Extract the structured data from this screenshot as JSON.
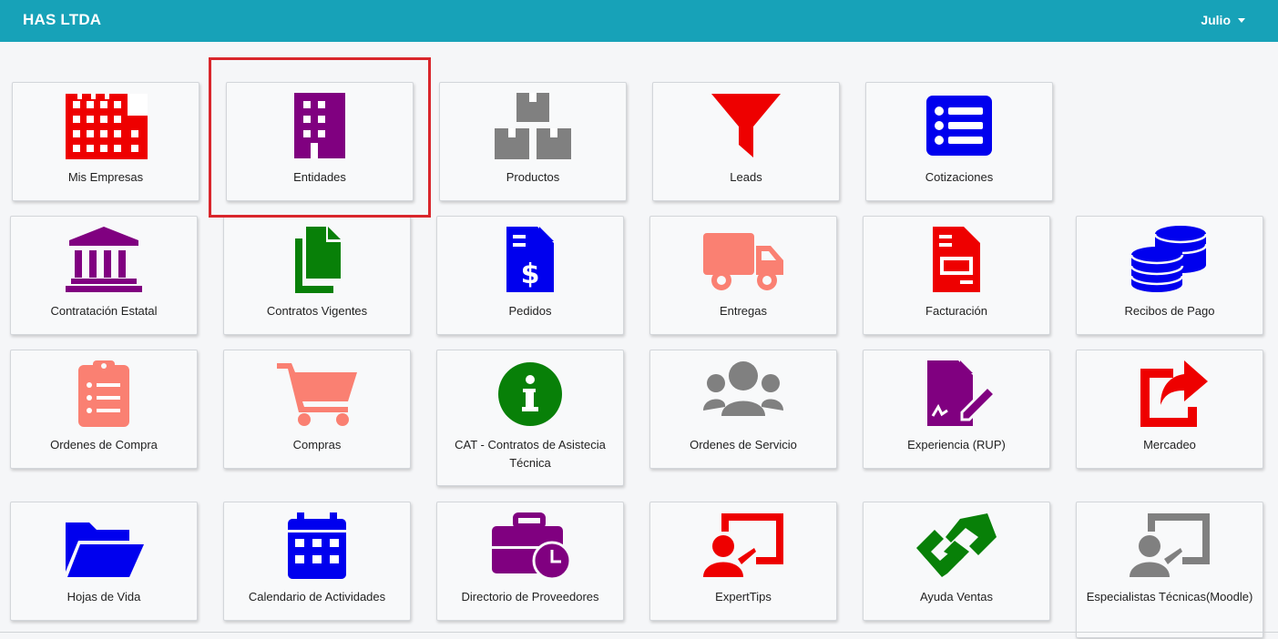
{
  "header": {
    "brand": "HAS LTDA",
    "user": "Julio"
  },
  "colors": {
    "navbar": "#17a2b8",
    "red": "#ee0000",
    "purple": "#800080",
    "gray": "#808080",
    "blue": "#0000ee",
    "green": "#088008",
    "salmon": "#fa8072",
    "highlight": "#d9262c"
  },
  "tiles": [
    {
      "label": "Mis Empresas",
      "icon": "industry-icon",
      "color": "red"
    },
    {
      "label": "Entidades",
      "icon": "building-icon",
      "color": "purple",
      "highlighted": true
    },
    {
      "label": "Productos",
      "icon": "boxes-icon",
      "color": "gray"
    },
    {
      "label": "Leads",
      "icon": "funnel-icon",
      "color": "red"
    },
    {
      "label": "Cotizaciones",
      "icon": "list-icon",
      "color": "blue"
    },
    {
      "label": "Contratación Estatal",
      "icon": "bank-icon",
      "color": "purple"
    },
    {
      "label": "Contratos Vigentes",
      "icon": "copy-icon",
      "color": "green"
    },
    {
      "label": "Pedidos",
      "icon": "invoice-dollar-icon",
      "color": "blue"
    },
    {
      "label": "Entregas",
      "icon": "truck-icon",
      "color": "salmon"
    },
    {
      "label": "Facturación",
      "icon": "invoice-icon",
      "color": "red"
    },
    {
      "label": "Recibos de Pago",
      "icon": "coins-icon",
      "color": "blue"
    },
    {
      "label": "Ordenes de Compra",
      "icon": "clipboard-list-icon",
      "color": "salmon"
    },
    {
      "label": "Compras",
      "icon": "shopping-cart-icon",
      "color": "salmon"
    },
    {
      "label": "CAT - Contratos de Asistecia Técnica",
      "icon": "info-circle-icon",
      "color": "green"
    },
    {
      "label": "Ordenes de Servicio",
      "icon": "users-icon",
      "color": "gray"
    },
    {
      "label": "Experiencia (RUP)",
      "icon": "file-signature-icon",
      "color": "purple"
    },
    {
      "label": "Mercadeo",
      "icon": "share-square-icon",
      "color": "red"
    },
    {
      "label": "Hojas de Vida",
      "icon": "folder-open-icon",
      "color": "blue"
    },
    {
      "label": "Calendario de Actividades",
      "icon": "calendar-icon",
      "color": "blue"
    },
    {
      "label": "Directorio de Proveedores",
      "icon": "business-time-icon",
      "color": "purple"
    },
    {
      "label": "ExpertTips",
      "icon": "chalkboard-teacher-icon",
      "color": "red"
    },
    {
      "label": "Ayuda Ventas",
      "icon": "handshake-icon",
      "color": "green"
    },
    {
      "label": "Especialistas Técnicas(Moodle)",
      "icon": "chalkboard-teacher-icon",
      "color": "gray"
    }
  ]
}
